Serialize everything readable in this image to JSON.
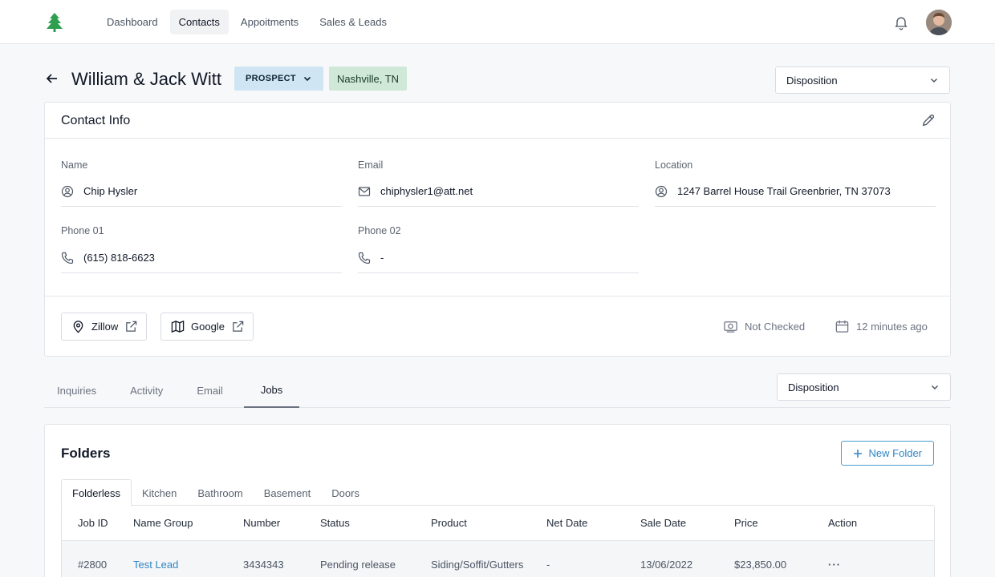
{
  "nav": {
    "items": [
      "Dashboard",
      "Contacts",
      "Appoitments",
      "Sales & Leads"
    ],
    "active_index": 1
  },
  "header": {
    "title": "William & Jack Witt",
    "status": "PROSPECT",
    "location": "Nashville, TN",
    "disposition": "Disposition"
  },
  "contact_info": {
    "title": "Contact Info",
    "fields": {
      "name": {
        "label": "Name",
        "value": "Chip Hysler"
      },
      "email": {
        "label": "Email",
        "value": "chiphysler1@att.net"
      },
      "location": {
        "label": "Location",
        "value": "1247 Barrel House Trail Greenbrier, TN 37073"
      },
      "phone1": {
        "label": "Phone 01",
        "value": "(615) 818-6623"
      },
      "phone2": {
        "label": "Phone 02",
        "value": "-"
      }
    },
    "links": {
      "zillow": "Zillow",
      "google": "Google"
    },
    "check_status": "Not Checked",
    "updated": "12 minutes ago"
  },
  "tabs": {
    "items": [
      "Inquiries",
      "Activity",
      "Email",
      "Jobs"
    ],
    "active_index": 3,
    "disposition": "Disposition"
  },
  "folders": {
    "title": "Folders",
    "new_folder": "New Folder",
    "tabs": [
      "Folderless",
      "Kitchen",
      "Bathroom",
      "Basement",
      "Doors"
    ],
    "active_tab": 0,
    "columns": [
      "Job ID",
      "Name Group",
      "Number",
      "Status",
      "Product",
      "Net Date",
      "Sale Date",
      "Price",
      "Action"
    ],
    "rows": [
      [
        "#2800",
        "Test Lead",
        "3434343",
        "Pending release",
        "Siding/Soffit/Gutters",
        "-",
        "13/06/2022",
        "$23,850.00",
        "···"
      ]
    ]
  },
  "colors": {
    "accent": "#2f86c4",
    "prospect_bg": "#cfe5f3",
    "location_bg": "#cfe8d8",
    "logo_green": "#2e9e4f"
  }
}
